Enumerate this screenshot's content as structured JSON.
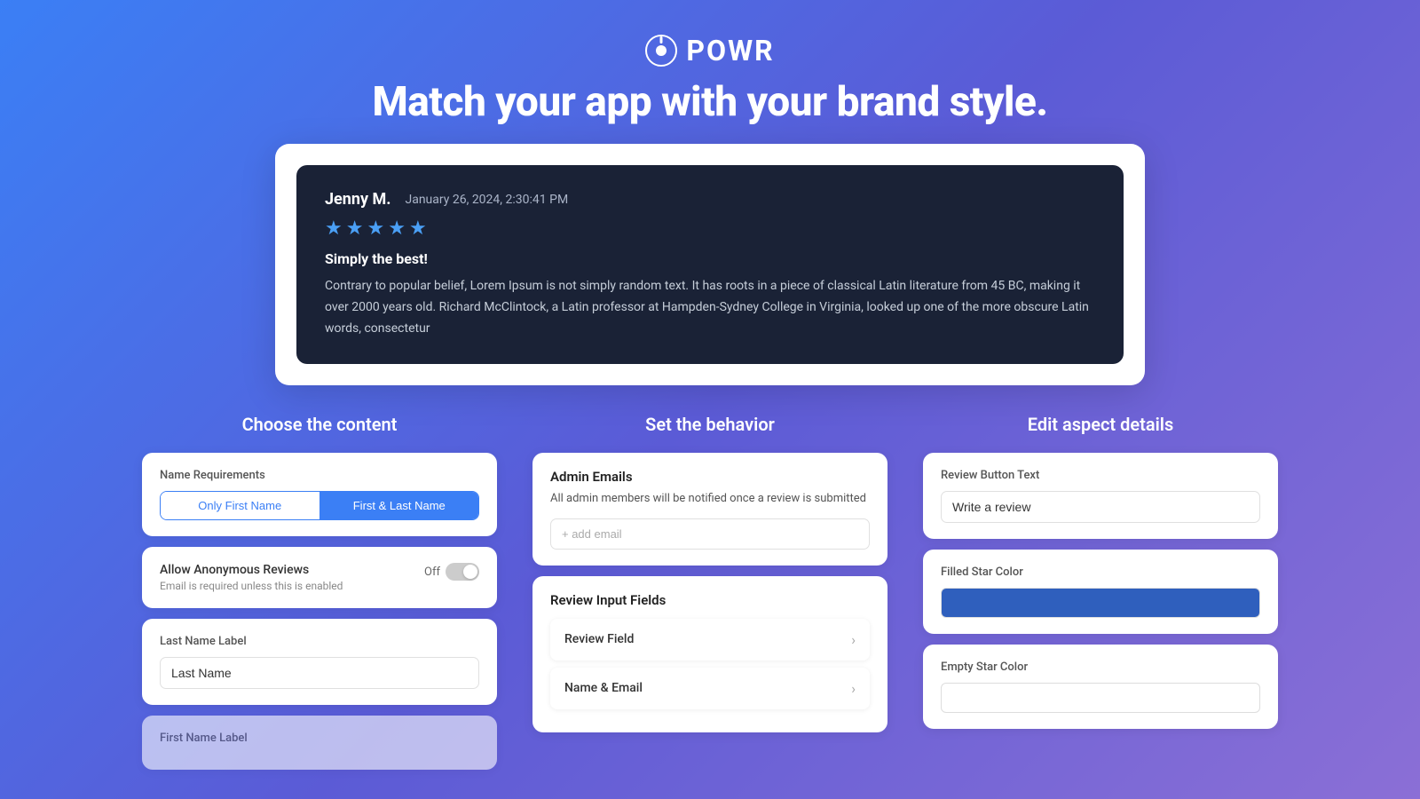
{
  "header": {
    "logo_text": "POWR",
    "headline": "Match your app with your brand style."
  },
  "review_card": {
    "reviewer_name": "Jenny M.",
    "review_date": "January 26, 2024, 2:30:41 PM",
    "stars": 5,
    "review_title": "Simply the best!",
    "review_body": "Contrary to popular belief, Lorem Ipsum is not simply random text. It has roots in a piece of classical Latin literature from 45 BC, making it over 2000 years old. Richard McClintock, a Latin professor at Hampden-Sydney College in Virginia, looked up one of the more obscure Latin words, consectetur"
  },
  "sections": {
    "content": {
      "title": "Choose the content",
      "name_requirements": {
        "label": "Name Requirements",
        "option1": "Only First Name",
        "option2": "First & Last Name",
        "active": "option2"
      },
      "anonymous_reviews": {
        "label": "Allow Anonymous Reviews",
        "sub_label": "Email is required unless this is enabled",
        "off_label": "Off",
        "is_on": false
      },
      "last_name_label": {
        "label": "Last Name Label",
        "value": "Last Name",
        "placeholder": "Last Name"
      },
      "first_name_label": {
        "label": "First Name Label"
      }
    },
    "behavior": {
      "title": "Set the behavior",
      "admin_emails": {
        "label": "Admin Emails",
        "description": "All admin members will be notified once a review is submitted",
        "add_placeholder": "+ add email"
      },
      "review_input_fields": {
        "label": "Review Input Fields",
        "fields": [
          {
            "name": "Review Field"
          },
          {
            "name": "Name & Email"
          }
        ]
      }
    },
    "aspect": {
      "title": "Edit aspect details",
      "review_button_text": {
        "label": "Review Button Text",
        "value": "Write a review"
      },
      "filled_star_color": {
        "label": "Filled Star Color",
        "color": "#2f5fbd"
      },
      "empty_star_color": {
        "label": "Empty Star Color",
        "color": "#ffffff"
      }
    }
  }
}
